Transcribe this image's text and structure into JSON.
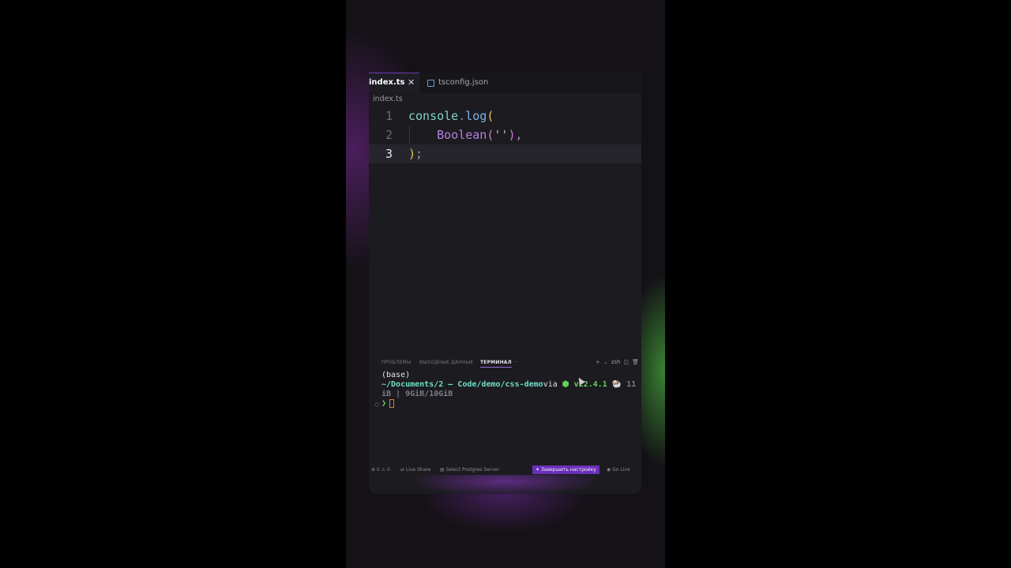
{
  "tabs": [
    {
      "label": "index.ts",
      "active": true
    },
    {
      "label": "tsconfig.json",
      "active": false
    }
  ],
  "breadcrumb": "index.ts",
  "code": {
    "line_numbers": [
      "1",
      "2",
      "3"
    ],
    "line1": {
      "obj": "console",
      "dot": ".",
      "fn": "log",
      "paren": "("
    },
    "line2": {
      "indent": "    ",
      "ctor": "Boolean",
      "open": "(",
      "str": "''",
      "close": ")",
      "comma": ","
    },
    "line3": {
      "paren": ")",
      "semi": ";"
    }
  },
  "panel": {
    "tabs": [
      "ПРОБЛЕМЫ",
      "ВЫХОДНЫЕ ДАННЫЕ",
      "ТЕРМИНАЛ"
    ],
    "more": "···",
    "shell": "zsh",
    "actions": {
      "add": "+",
      "chevron": "⌄",
      "split": "◫",
      "trash": "🗑"
    }
  },
  "terminal": {
    "base": "(base)",
    "path": "~/Documents/2 – Code/demo/css-demo",
    "via": "via",
    "node_icon": "⬢",
    "version": "v22.4.1",
    "mem_icon": "🐏",
    "mem_start": "11",
    "mem_end": "iB | 9GiB/10GiB",
    "prompt": "❯"
  },
  "statusbar": {
    "errors": "⊗ 0 ⚠ 0",
    "live_share": "Live Share",
    "postgres": "Select Postgres Server",
    "setup": "Завершить настройку",
    "go_live": "Go Live"
  },
  "colors": {
    "accent": "#6a2fb8",
    "editor_bg": "#1c1b20",
    "path": "#6ee0c7",
    "version": "#63d15c"
  }
}
